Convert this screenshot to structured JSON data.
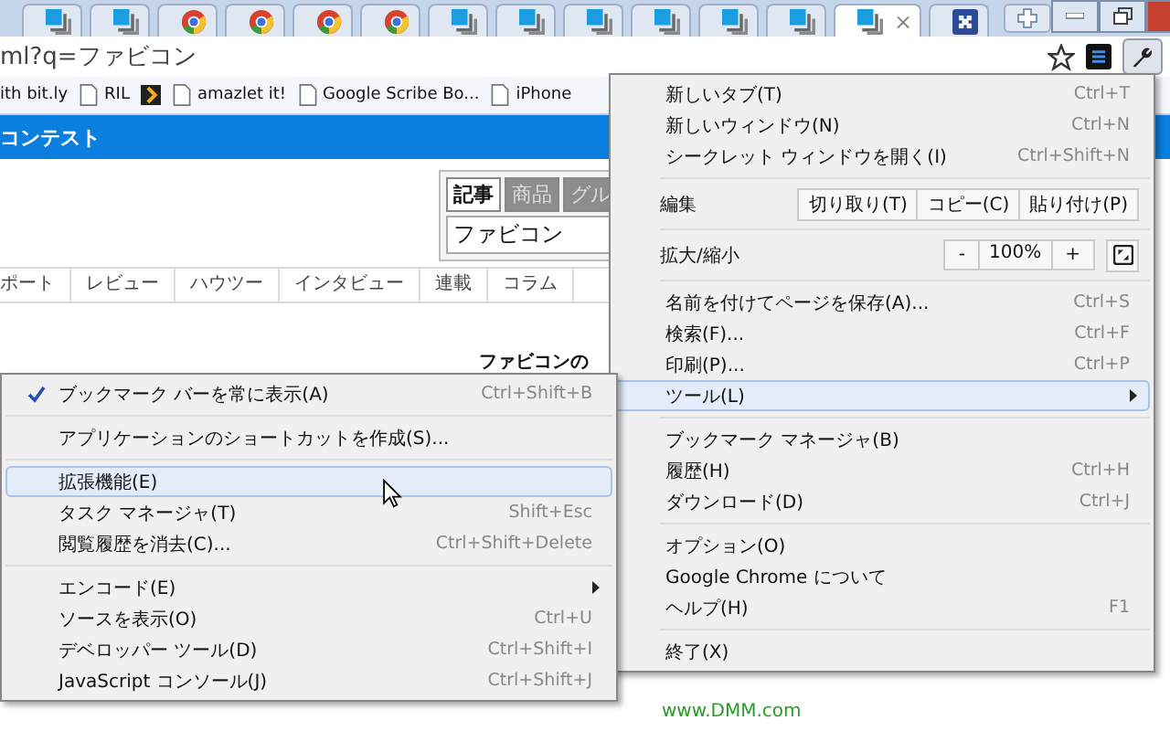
{
  "tabs": [
    {
      "kind": "doc",
      "selected": false
    },
    {
      "kind": "doc",
      "selected": false
    },
    {
      "kind": "chrome",
      "selected": false
    },
    {
      "kind": "chrome",
      "selected": false
    },
    {
      "kind": "chrome",
      "selected": false
    },
    {
      "kind": "chrome",
      "selected": false
    },
    {
      "kind": "doc",
      "selected": false
    },
    {
      "kind": "doc",
      "selected": false
    },
    {
      "kind": "doc",
      "selected": false
    },
    {
      "kind": "doc",
      "selected": false
    },
    {
      "kind": "doc",
      "selected": false
    },
    {
      "kind": "doc",
      "selected": false
    },
    {
      "kind": "doc",
      "selected": true,
      "close": "×"
    },
    {
      "kind": "puzzle",
      "selected": false
    }
  ],
  "address": "ml?q=ファビコン",
  "bookmarks": [
    {
      "kind": "plain",
      "label": "ith bit.ly"
    },
    {
      "kind": "doc",
      "label": "RIL"
    },
    {
      "kind": "arrow"
    },
    {
      "kind": "doc",
      "label": "amazlet it!"
    },
    {
      "kind": "doc",
      "label": "Google Scribe Bo..."
    },
    {
      "kind": "doc",
      "label": "iPhone"
    }
  ],
  "page": {
    "banner": "コンテスト",
    "search_tabs": [
      {
        "label": "記事",
        "selected": true
      },
      {
        "label": "商品",
        "selected": false
      },
      {
        "label": "グル",
        "selected": false
      }
    ],
    "search_value": "ファビコン",
    "nav": [
      "ポート",
      "レビュー",
      "ハウツー",
      "インタビュー",
      "連載",
      "コラム"
    ],
    "heading": "ファビコンの",
    "link": "www.DMM.com"
  },
  "menu": [
    {
      "kind": "item",
      "label": "新しいタブ(T)",
      "shortcut": "Ctrl+T"
    },
    {
      "kind": "item",
      "label": "新しいウィンドウ(N)",
      "shortcut": "Ctrl+N"
    },
    {
      "kind": "item",
      "label": "シークレット ウィンドウを開く(I)",
      "shortcut": "Ctrl+Shift+N"
    },
    {
      "kind": "separator"
    },
    {
      "kind": "edit",
      "label": "編集",
      "buttons": [
        "切り取り(T)",
        "コピー(C)",
        "貼り付け(P)"
      ]
    },
    {
      "kind": "separator"
    },
    {
      "kind": "zoom",
      "label": "拡大/縮小",
      "minus": "-",
      "value": "100%",
      "plus": "+"
    },
    {
      "kind": "separator"
    },
    {
      "kind": "item",
      "label": "名前を付けてページを保存(A)...",
      "shortcut": "Ctrl+S"
    },
    {
      "kind": "item",
      "label": "検索(F)...",
      "shortcut": "Ctrl+F"
    },
    {
      "kind": "item",
      "label": "印刷(P)...",
      "shortcut": "Ctrl+P"
    },
    {
      "kind": "item",
      "label": "ツール(L)",
      "submenu": true,
      "highlighted": true
    },
    {
      "kind": "separator"
    },
    {
      "kind": "item",
      "label": "ブックマーク マネージャ(B)"
    },
    {
      "kind": "item",
      "label": "履歴(H)",
      "shortcut": "Ctrl+H"
    },
    {
      "kind": "item",
      "label": "ダウンロード(D)",
      "shortcut": "Ctrl+J"
    },
    {
      "kind": "separator"
    },
    {
      "kind": "item",
      "label": "オプション(O)"
    },
    {
      "kind": "item",
      "label": "Google Chrome について"
    },
    {
      "kind": "item",
      "label": "ヘルプ(H)",
      "shortcut": "F1"
    },
    {
      "kind": "separator"
    },
    {
      "kind": "item",
      "label": "終了(X)"
    }
  ],
  "submenu": [
    {
      "kind": "item",
      "label": "ブックマーク バーを常に表示(A)",
      "shortcut": "Ctrl+Shift+B",
      "checked": true
    },
    {
      "kind": "separator"
    },
    {
      "kind": "item",
      "label": "アプリケーションのショートカットを作成(S)..."
    },
    {
      "kind": "separator"
    },
    {
      "kind": "item",
      "label": "拡張機能(E)",
      "highlighted": true
    },
    {
      "kind": "item",
      "label": "タスク マネージャ(T)",
      "shortcut": "Shift+Esc"
    },
    {
      "kind": "item",
      "label": "閲覧履歴を消去(C)...",
      "shortcut": "Ctrl+Shift+Delete"
    },
    {
      "kind": "separator"
    },
    {
      "kind": "item",
      "label": "エンコード(E)",
      "submenu": true
    },
    {
      "kind": "item",
      "label": "ソースを表示(O)",
      "shortcut": "Ctrl+U"
    },
    {
      "kind": "item",
      "label": "デベロッパー ツール(D)",
      "shortcut": "Ctrl+Shift+I"
    },
    {
      "kind": "item",
      "label": "JavaScript コンソール(J)",
      "shortcut": "Ctrl+Shift+J"
    }
  ]
}
